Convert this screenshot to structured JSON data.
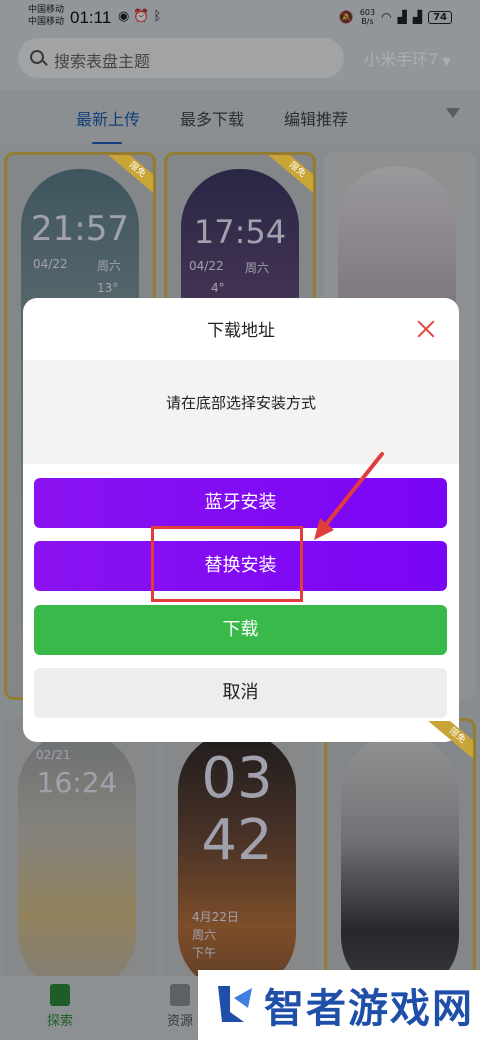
{
  "status_bar": {
    "carrier_1": "中国移动",
    "carrier_2": "中国移动",
    "time": "01:11",
    "net_speed_value": "603",
    "net_speed_unit": "B/s",
    "battery": "74"
  },
  "header": {
    "search_placeholder": "搜索表盘主题",
    "device": "小米手环7"
  },
  "tabs": [
    "最新上传",
    "最多下载",
    "编辑推荐"
  ],
  "cards": {
    "c1": {
      "time": "21:57",
      "date": "04/22",
      "weekday": "周六",
      "temp": "13°",
      "vip": "限免"
    },
    "c2": {
      "time": "17:54",
      "date": "04/22",
      "weekday": "周六",
      "temp": "4°",
      "vip": "限免"
    },
    "c4": {
      "time": "16:24",
      "date": "02/21"
    },
    "c5": {
      "hour": "03",
      "minute": "42",
      "date": "4月22日",
      "weekday": "周六",
      "period": "下午"
    },
    "c6": {
      "vip": "限免"
    }
  },
  "bottom_nav": {
    "explore": "探索",
    "resources": "资源"
  },
  "watermark": {
    "text": "智者游戏网"
  },
  "dialog": {
    "title": "下载地址",
    "message": "请在底部选择安装方式",
    "bluetooth_install": "蓝牙安装",
    "replace_install": "替换安装",
    "download": "下载",
    "cancel": "取消"
  },
  "colors": {
    "accent_purple": "#8a12f0",
    "download_green": "#38b94a",
    "tab_active_blue": "#1c5fb8",
    "annotation_red": "#e23c3c"
  }
}
